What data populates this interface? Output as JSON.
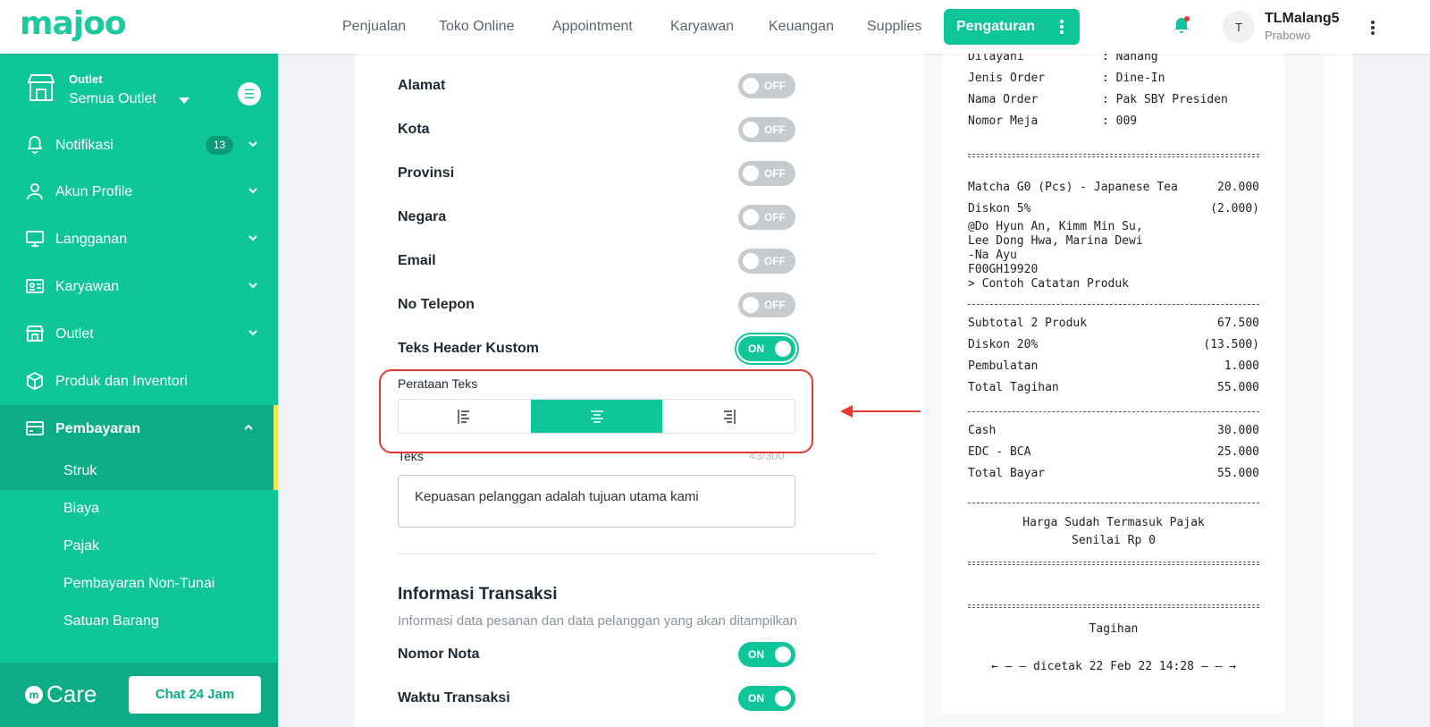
{
  "brand": "majoo",
  "nav": {
    "items": [
      "Penjualan",
      "Toko Online",
      "Appointment",
      "Karyawan",
      "Keuangan",
      "Supplies"
    ],
    "active": "Pengaturan"
  },
  "user": {
    "initial": "T",
    "name": "TLMalang5",
    "sub": "Prabowo"
  },
  "sidebar": {
    "outlet_label": "Outlet",
    "outlet_value": "Semua Outlet",
    "items": [
      {
        "label": "Notifikasi",
        "badge": "13"
      },
      {
        "label": "Akun Profile"
      },
      {
        "label": "Langganan"
      },
      {
        "label": "Karyawan"
      },
      {
        "label": "Outlet"
      },
      {
        "label": "Produk dan Inventori"
      },
      {
        "label": "Pembayaran"
      }
    ],
    "sub_items": [
      "Struk",
      "Biaya",
      "Pajak",
      "Pembayaran Non-Tunai",
      "Satuan Barang"
    ],
    "care_label": "Care",
    "chat_button": "Chat 24 Jam"
  },
  "settings": {
    "rows": [
      {
        "label": "Alamat",
        "state": "OFF"
      },
      {
        "label": "Kota",
        "state": "OFF"
      },
      {
        "label": "Provinsi",
        "state": "OFF"
      },
      {
        "label": "Negara",
        "state": "OFF"
      },
      {
        "label": "Email",
        "state": "OFF"
      },
      {
        "label": "No Telepon",
        "state": "OFF"
      },
      {
        "label": "Teks Header Kustom",
        "state": "ON"
      }
    ],
    "alignment_label": "Perataan Teks",
    "alignment_selected": "center",
    "teks_label": "Teks",
    "teks_count": "43/300",
    "teks_value": "Kepuasan pelanggan adalah tujuan utama kami",
    "section_title": "Informasi Transaksi",
    "section_desc": "Informasi data pesanan dan data pelanggan yang akan ditampilkan",
    "trx_rows": [
      {
        "label": "Nomor Nota",
        "state": "ON"
      },
      {
        "label": "Waktu Transaksi",
        "state": "ON"
      }
    ]
  },
  "receipt": {
    "info": [
      {
        "k": "Dilayani",
        "v": ": Nanang"
      },
      {
        "k": "Jenis Order",
        "v": ": Dine-In"
      },
      {
        "k": "Nama Order",
        "v": ": Pak SBY Presiden"
      },
      {
        "k": "Nomor Meja",
        "v": ": 009"
      }
    ],
    "item_name": "Matcha G0 (Pcs) - Japanese Tea",
    "item_price": "20.000",
    "item_disc": "Diskon 5%",
    "item_disc_val": "(2.000)",
    "notes": [
      "@Do Hyun An, Kimm Min Su,",
      "Lee Dong Hwa, Marina Dewi",
      "-Na Ayu",
      "F00GH19920",
      "> Contoh Catatan Produk"
    ],
    "totals": [
      {
        "k": "Subtotal 2 Produk",
        "v": "67.500"
      },
      {
        "k": "Diskon 20%",
        "v": "(13.500)"
      },
      {
        "k": "Pembulatan",
        "v": "1.000"
      },
      {
        "k": "Total Tagihan",
        "v": "55.000"
      }
    ],
    "payments": [
      {
        "k": "Cash",
        "v": "30.000"
      },
      {
        "k": "EDC - BCA",
        "v": "25.000"
      },
      {
        "k": "Total Bayar",
        "v": "55.000"
      }
    ],
    "tax_note_1": "Harga Sudah Termasuk Pajak",
    "tax_note_2": "Senilai Rp 0",
    "tagihan": "Tagihan",
    "printed": "← – – dicetak 22 Feb 22 14:28 – – →"
  },
  "colors": {
    "accent": "#0fc69a",
    "sidebar_active": "#0cad86",
    "highlight": "#e53935"
  }
}
